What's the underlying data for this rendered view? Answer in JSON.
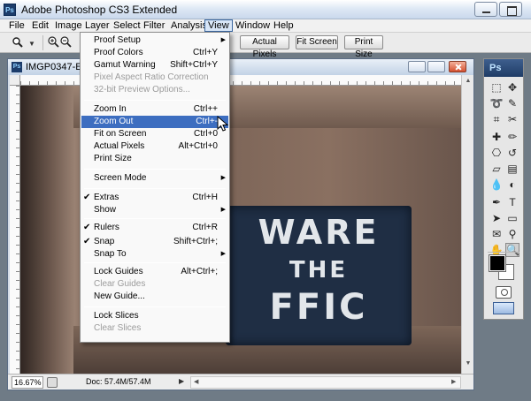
{
  "app": {
    "title": "Adobe Photoshop CS3 Extended",
    "icon_text": "Ps"
  },
  "menubar": [
    {
      "label": "File"
    },
    {
      "label": "Edit"
    },
    {
      "label": "Image"
    },
    {
      "label": "Layer"
    },
    {
      "label": "Select"
    },
    {
      "label": "Filter"
    },
    {
      "label": "Analysis"
    },
    {
      "label": "View"
    },
    {
      "label": "Window"
    },
    {
      "label": "Help"
    }
  ],
  "options_bar": {
    "actual_pixels_label": "Actual Pixels",
    "fit_screen_label": "Fit Screen",
    "print_size_label": "Print Size"
  },
  "document": {
    "title": "IMGP0347-Edit",
    "icon_text": "Ps",
    "sign_lines": [
      "WARE",
      "THE",
      "FFIC"
    ],
    "zoom": "16.67%",
    "doc_size": "Doc: 57.4M/57.4M"
  },
  "view_menu": {
    "items": [
      {
        "label": "Proof Setup",
        "shortcut": "",
        "submenu": true,
        "enabled": true,
        "checked": false
      },
      {
        "label": "Proof Colors",
        "shortcut": "Ctrl+Y",
        "submenu": false,
        "enabled": true,
        "checked": false
      },
      {
        "label": "Gamut Warning",
        "shortcut": "Shift+Ctrl+Y",
        "submenu": false,
        "enabled": true,
        "checked": false
      },
      {
        "label": "Pixel Aspect Ratio Correction",
        "shortcut": "",
        "submenu": false,
        "enabled": false,
        "checked": false
      },
      {
        "label": "32-bit Preview Options...",
        "shortcut": "",
        "submenu": false,
        "enabled": false,
        "checked": false
      },
      {
        "label": "Zoom In",
        "shortcut": "Ctrl++",
        "submenu": false,
        "enabled": true,
        "checked": false
      },
      {
        "label": "Zoom Out",
        "shortcut": "Ctrl+-",
        "submenu": false,
        "enabled": true,
        "checked": false,
        "highlighted": true
      },
      {
        "label": "Fit on Screen",
        "shortcut": "Ctrl+0",
        "submenu": false,
        "enabled": true,
        "checked": false
      },
      {
        "label": "Actual Pixels",
        "shortcut": "Alt+Ctrl+0",
        "submenu": false,
        "enabled": true,
        "checked": false
      },
      {
        "label": "Print Size",
        "shortcut": "",
        "submenu": false,
        "enabled": true,
        "checked": false
      },
      {
        "label": "Screen Mode",
        "shortcut": "",
        "submenu": true,
        "enabled": true,
        "checked": false
      },
      {
        "label": "Extras",
        "shortcut": "Ctrl+H",
        "submenu": false,
        "enabled": true,
        "checked": true
      },
      {
        "label": "Show",
        "shortcut": "",
        "submenu": true,
        "enabled": true,
        "checked": false
      },
      {
        "label": "Rulers",
        "shortcut": "Ctrl+R",
        "submenu": false,
        "enabled": true,
        "checked": true
      },
      {
        "label": "Snap",
        "shortcut": "Shift+Ctrl+;",
        "submenu": false,
        "enabled": true,
        "checked": true
      },
      {
        "label": "Snap To",
        "shortcut": "",
        "submenu": true,
        "enabled": true,
        "checked": false
      },
      {
        "label": "Lock Guides",
        "shortcut": "Alt+Ctrl+;",
        "submenu": false,
        "enabled": true,
        "checked": false
      },
      {
        "label": "Clear Guides",
        "shortcut": "",
        "submenu": false,
        "enabled": false,
        "checked": false
      },
      {
        "label": "New Guide...",
        "shortcut": "",
        "submenu": false,
        "enabled": true,
        "checked": false
      },
      {
        "label": "Lock Slices",
        "shortcut": "",
        "submenu": false,
        "enabled": true,
        "checked": false
      },
      {
        "label": "Clear Slices",
        "shortcut": "",
        "submenu": false,
        "enabled": false,
        "checked": false
      }
    ]
  },
  "tools_panel": {
    "header": "Ps",
    "tools": [
      {
        "name": "marquee-tool",
        "glyph": "⬚"
      },
      {
        "name": "move-tool",
        "glyph": "✥"
      },
      {
        "name": "lasso-tool",
        "glyph": "➰"
      },
      {
        "name": "quick-selection-tool",
        "glyph": "✎"
      },
      {
        "name": "crop-tool",
        "glyph": "⌗"
      },
      {
        "name": "slice-tool",
        "glyph": "✂"
      },
      {
        "name": "healing-brush-tool",
        "glyph": "✚"
      },
      {
        "name": "brush-tool",
        "glyph": "✏"
      },
      {
        "name": "clone-stamp-tool",
        "glyph": "⎔"
      },
      {
        "name": "history-brush-tool",
        "glyph": "↺"
      },
      {
        "name": "eraser-tool",
        "glyph": "▱"
      },
      {
        "name": "gradient-tool",
        "glyph": "▤"
      },
      {
        "name": "blur-tool",
        "glyph": "💧"
      },
      {
        "name": "dodge-tool",
        "glyph": "◐"
      },
      {
        "name": "pen-tool",
        "glyph": "✒"
      },
      {
        "name": "type-tool",
        "glyph": "T"
      },
      {
        "name": "path-selection-tool",
        "glyph": "➤"
      },
      {
        "name": "shape-tool",
        "glyph": "▭"
      },
      {
        "name": "notes-tool",
        "glyph": "✉"
      },
      {
        "name": "eyedropper-tool",
        "glyph": "⚲"
      },
      {
        "name": "hand-tool",
        "glyph": "✋"
      },
      {
        "name": "zoom-tool",
        "glyph": "🔍"
      }
    ]
  }
}
